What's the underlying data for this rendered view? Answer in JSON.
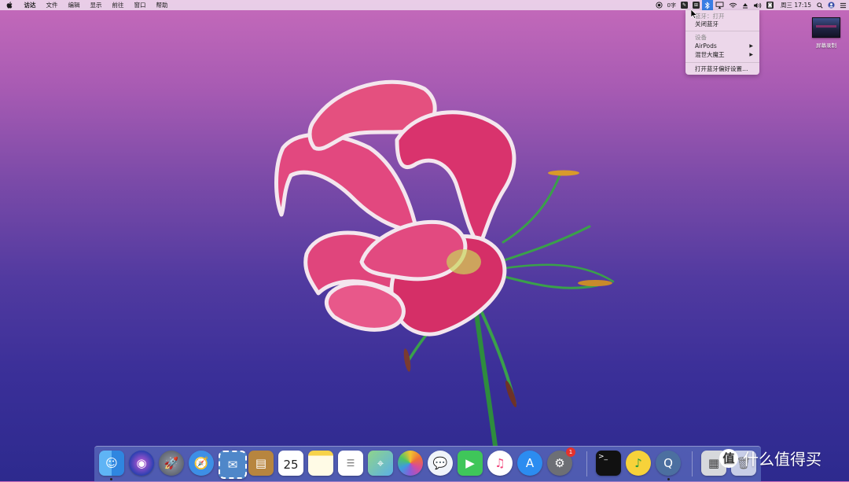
{
  "menubar": {
    "app_name": "访达",
    "items": [
      "文件",
      "编辑",
      "显示",
      "前往",
      "窗口",
      "帮助"
    ],
    "status": {
      "input_method": "0字",
      "weekday": "周三",
      "time": "17:15"
    }
  },
  "bluetooth_menu": {
    "status": "蓝牙：打开",
    "toggle": "关闭蓝牙",
    "section_devices": "设备",
    "devices": [
      "AirPods",
      "混世大魔王"
    ],
    "preferences": "打开蓝牙偏好设置…"
  },
  "desktop": {
    "item_label": "屏幕录制"
  },
  "dock": {
    "apps": [
      {
        "icon": "finder-icon"
      },
      {
        "icon": "siri-icon"
      },
      {
        "icon": "launchpad-icon"
      },
      {
        "icon": "safari-icon"
      },
      {
        "icon": "mail-stamp-icon"
      },
      {
        "icon": "contacts-icon"
      },
      {
        "icon": "calendar-icon",
        "month": "",
        "day": "25"
      },
      {
        "icon": "notes-icon"
      },
      {
        "icon": "reminders-icon"
      },
      {
        "icon": "maps-icon"
      },
      {
        "icon": "photos-icon"
      },
      {
        "icon": "messages-icon"
      },
      {
        "icon": "facetime-icon"
      },
      {
        "icon": "music-icon"
      },
      {
        "icon": "app-store-icon"
      },
      {
        "icon": "system-preferences-icon",
        "badge": "1"
      },
      {
        "icon": "terminal-icon"
      },
      {
        "icon": "qq-music-icon"
      },
      {
        "icon": "quicktime-icon"
      },
      {
        "icon": "preview-icon"
      },
      {
        "icon": "trash-icon"
      }
    ]
  },
  "watermark": {
    "text": "什么值得买",
    "logo_char": "值"
  },
  "colors": {
    "menubar_bg": "#ecd6ea",
    "highlight": "#3a7de4",
    "badge": "#e5322d"
  }
}
